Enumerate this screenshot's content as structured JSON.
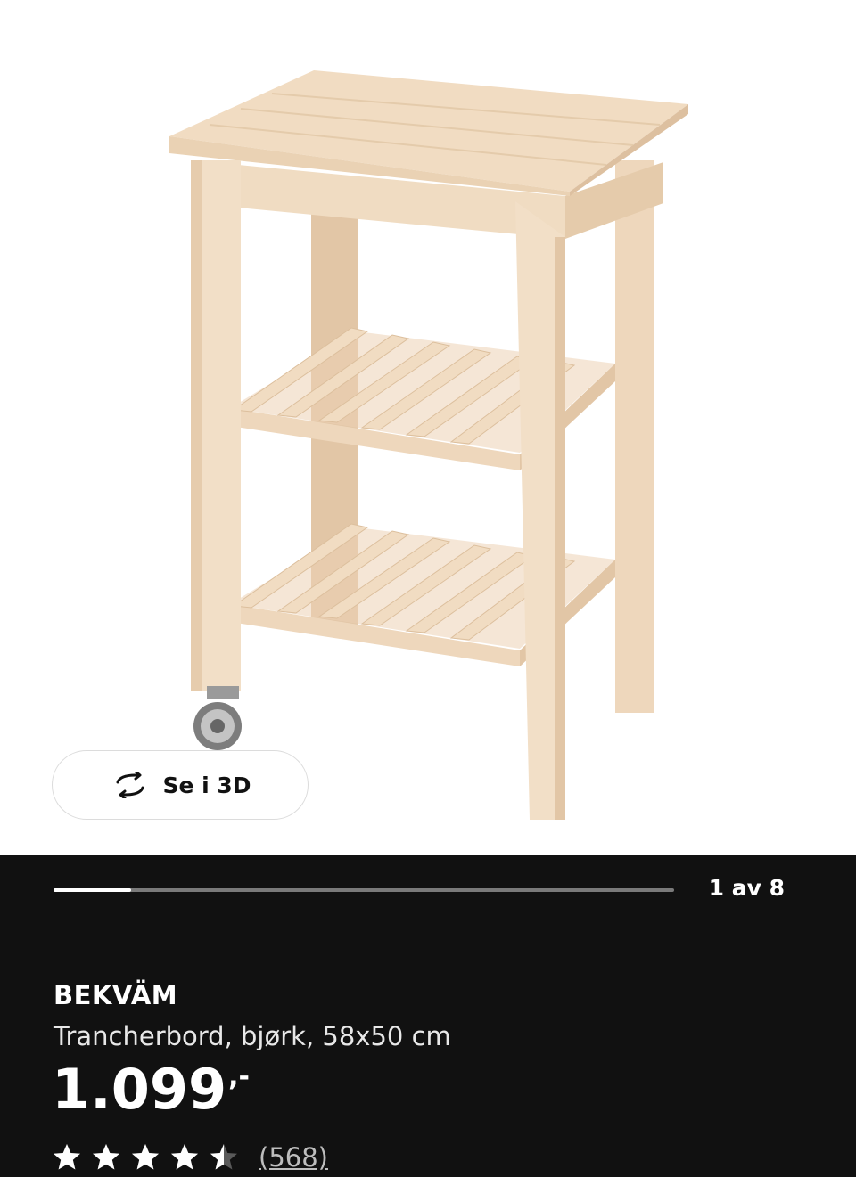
{
  "product": {
    "name": "BEKVÄM",
    "description": "Trancherbord, bjørk, 58x50 cm",
    "price": "1.099",
    "price_suffix": ",-",
    "rating": 4.5,
    "rating_max": 5,
    "review_count": "(568)",
    "image": "wooden-kitchen-cart-image"
  },
  "gallery": {
    "view_3d_label": "Se i 3D",
    "view_3d_icon": "rotate-3d-icon",
    "pager_text": "1 av 8",
    "progress_fraction": 0.125
  },
  "colors": {
    "panel_background": "#111111",
    "text": "#ffffff",
    "progress_track": "#7a7a7a",
    "wood": "#efd9bf"
  }
}
